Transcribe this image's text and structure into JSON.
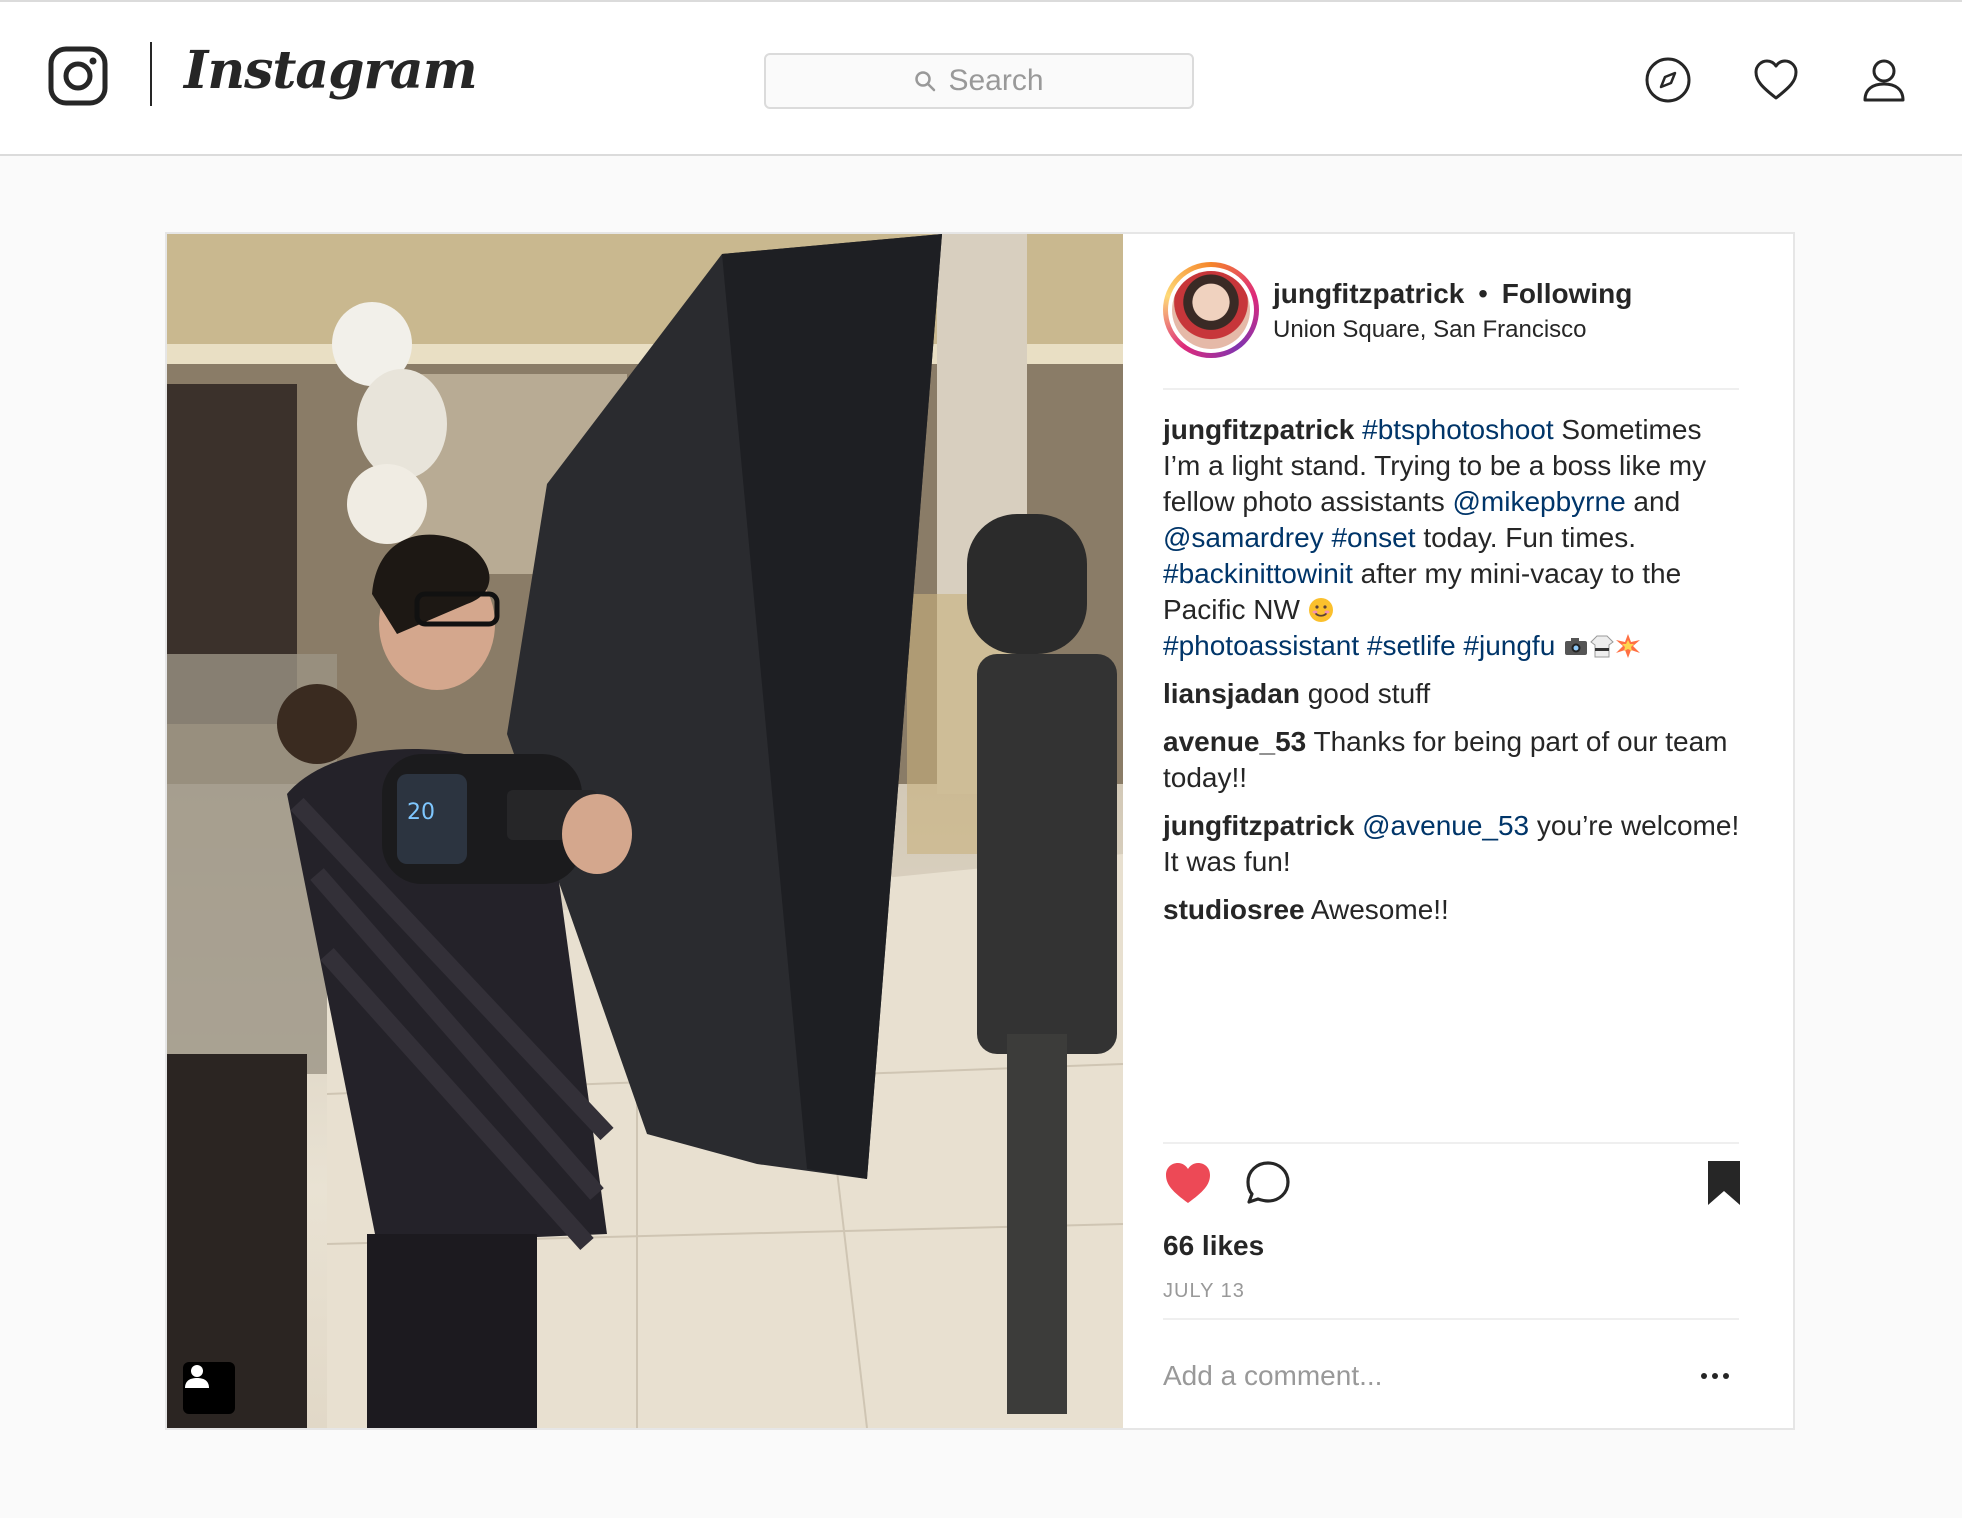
{
  "nav": {
    "brand": "Instagram",
    "search_placeholder": "Search",
    "icons": [
      "camera-logo-icon",
      "search-icon",
      "compass-icon",
      "heart-icon",
      "profile-icon"
    ]
  },
  "post": {
    "author": {
      "username": "jungfitzpatrick",
      "separator": "•",
      "follow_status": "Following",
      "location": "Union Square, San Francisco"
    },
    "caption": {
      "username": "jungfitzpatrick",
      "segments": [
        {
          "type": "link",
          "text": "#btsphotoshoot"
        },
        {
          "type": "text",
          "text": " Sometimes I’m a light stand. Trying to be a boss like my fellow photo assistants "
        },
        {
          "type": "link",
          "text": "@mikepbyrne"
        },
        {
          "type": "text",
          "text": " and "
        },
        {
          "type": "link",
          "text": "@samardrey"
        },
        {
          "type": "text",
          "text": " "
        },
        {
          "type": "link",
          "text": "#onset"
        },
        {
          "type": "text",
          "text": " today. Fun times. "
        },
        {
          "type": "link",
          "text": "#backinittowinit"
        },
        {
          "type": "text",
          "text": " after my mini-vacay to the Pacific NW"
        },
        {
          "type": "link",
          "text": "#photoassistant"
        },
        {
          "type": "text",
          "text": " "
        },
        {
          "type": "link",
          "text": "#setlife"
        },
        {
          "type": "text",
          "text": " "
        },
        {
          "type": "link",
          "text": "#jungfu"
        }
      ],
      "emojis": [
        "smiling-face-emoji",
        "camera-emoji",
        "martial-arts-uniform-emoji",
        "collision-emoji"
      ]
    },
    "comments": [
      {
        "username": "liansjadan",
        "text": "good stuff"
      },
      {
        "username": "avenue_53",
        "text": "Thanks for being part of our team today!!"
      },
      {
        "username": "jungfitzpatrick",
        "mention": "@avenue_53",
        "text": "you’re welcome! It was fun!"
      },
      {
        "username": "studiosree",
        "text": "Awesome!!"
      }
    ],
    "likes": "66 likes",
    "date": "JULY 13",
    "add_comment_placeholder": "Add a comment...",
    "liked": true,
    "saved": true,
    "colors": {
      "like_red": "#ed4956",
      "link_blue": "#003569",
      "muted_gray": "#999999"
    }
  }
}
